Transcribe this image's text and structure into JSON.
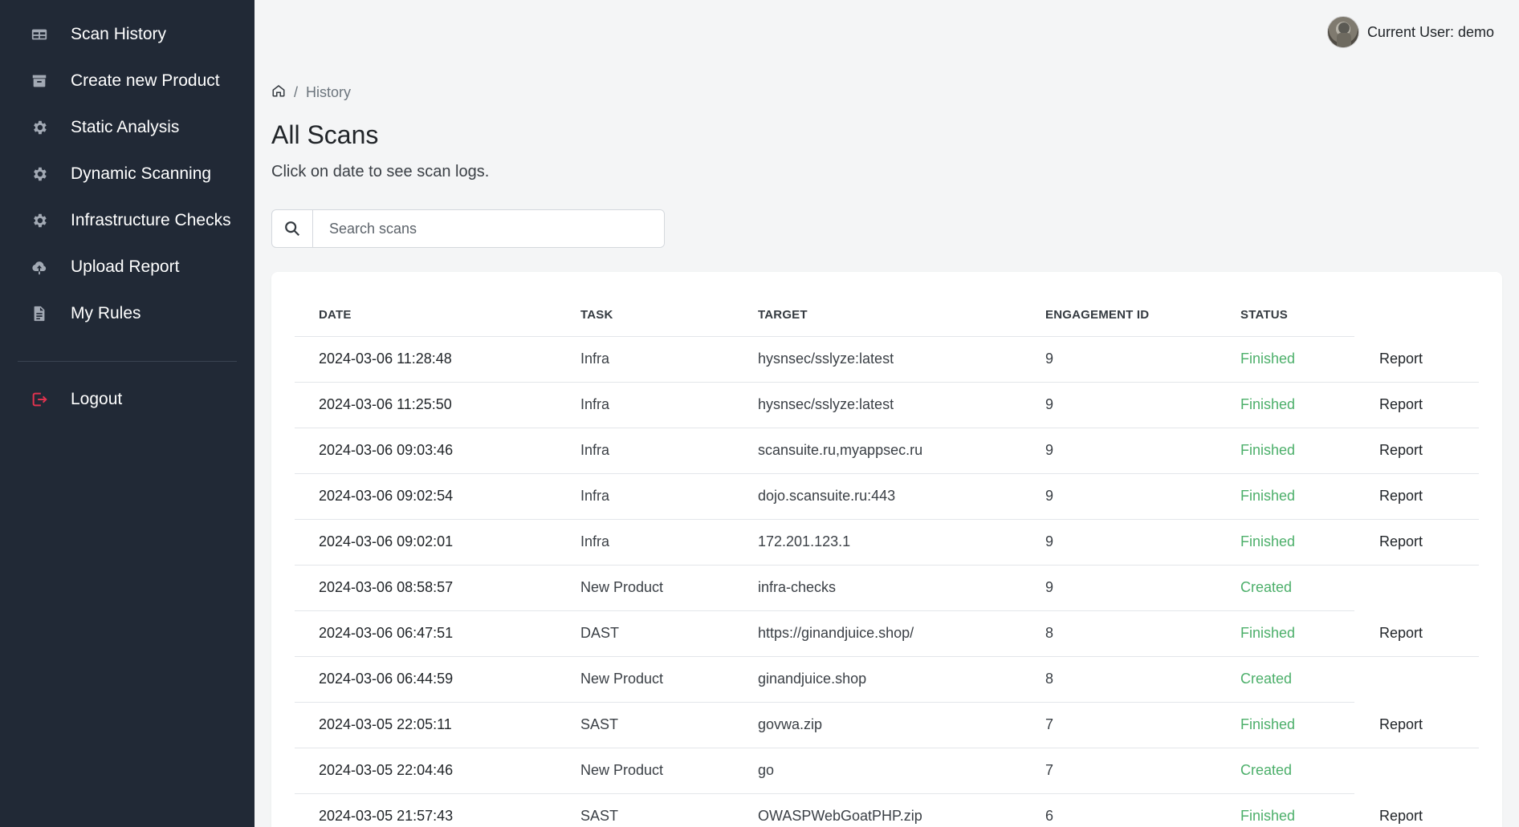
{
  "sidebar": {
    "items": [
      {
        "label": "Scan History",
        "icon": "table-icon"
      },
      {
        "label": "Create new Product",
        "icon": "archive-icon"
      },
      {
        "label": "Static Analysis",
        "icon": "gear-icon"
      },
      {
        "label": "Dynamic Scanning",
        "icon": "gear-icon"
      },
      {
        "label": "Infrastructure Checks",
        "icon": "gear-icon"
      },
      {
        "label": "Upload Report",
        "icon": "cloud-upload-icon"
      },
      {
        "label": "My Rules",
        "icon": "document-icon"
      }
    ],
    "logout": {
      "label": "Logout",
      "icon": "logout-icon",
      "color": "#e0334f"
    }
  },
  "header": {
    "user_label": "Current User: demo"
  },
  "breadcrumb": {
    "current": "History"
  },
  "main": {
    "title": "All Scans",
    "subtitle": "Click on date to see scan logs.",
    "search_placeholder": "Search scans"
  },
  "table": {
    "columns": [
      "DATE",
      "TASK",
      "TARGET",
      "ENGAGEMENT ID",
      "STATUS"
    ],
    "rows": [
      {
        "date": "2024-03-06 11:28:48",
        "task": "Infra",
        "target": "hysnsec/sslyze:latest",
        "engagement": "9",
        "status": "Finished",
        "action": "Report"
      },
      {
        "date": "2024-03-06 11:25:50",
        "task": "Infra",
        "target": "hysnsec/sslyze:latest",
        "engagement": "9",
        "status": "Finished",
        "action": "Report"
      },
      {
        "date": "2024-03-06 09:03:46",
        "task": "Infra",
        "target": "scansuite.ru,myappsec.ru",
        "engagement": "9",
        "status": "Finished",
        "action": "Report"
      },
      {
        "date": "2024-03-06 09:02:54",
        "task": "Infra",
        "target": "dojo.scansuite.ru:443",
        "engagement": "9",
        "status": "Finished",
        "action": "Report"
      },
      {
        "date": "2024-03-06 09:02:01",
        "task": "Infra",
        "target": "172.201.123.1",
        "engagement": "9",
        "status": "Finished",
        "action": "Report"
      },
      {
        "date": "2024-03-06 08:58:57",
        "task": "New Product",
        "target": "infra-checks",
        "engagement": "9",
        "status": "Created",
        "action": ""
      },
      {
        "date": "2024-03-06 06:47:51",
        "task": "DAST",
        "target": "https://ginandjuice.shop/",
        "engagement": "8",
        "status": "Finished",
        "action": "Report"
      },
      {
        "date": "2024-03-06 06:44:59",
        "task": "New Product",
        "target": "ginandjuice.shop",
        "engagement": "8",
        "status": "Created",
        "action": ""
      },
      {
        "date": "2024-03-05 22:05:11",
        "task": "SAST",
        "target": "govwa.zip",
        "engagement": "7",
        "status": "Finished",
        "action": "Report"
      },
      {
        "date": "2024-03-05 22:04:46",
        "task": "New Product",
        "target": "go",
        "engagement": "7",
        "status": "Created",
        "action": ""
      },
      {
        "date": "2024-03-05 21:57:43",
        "task": "SAST",
        "target": "OWASPWebGoatPHP.zip",
        "engagement": "6",
        "status": "Finished",
        "action": "Report"
      }
    ]
  },
  "colors": {
    "sidebar_bg": "#212936",
    "status_green": "#4caf6a",
    "page_bg": "#f4f5f6"
  }
}
